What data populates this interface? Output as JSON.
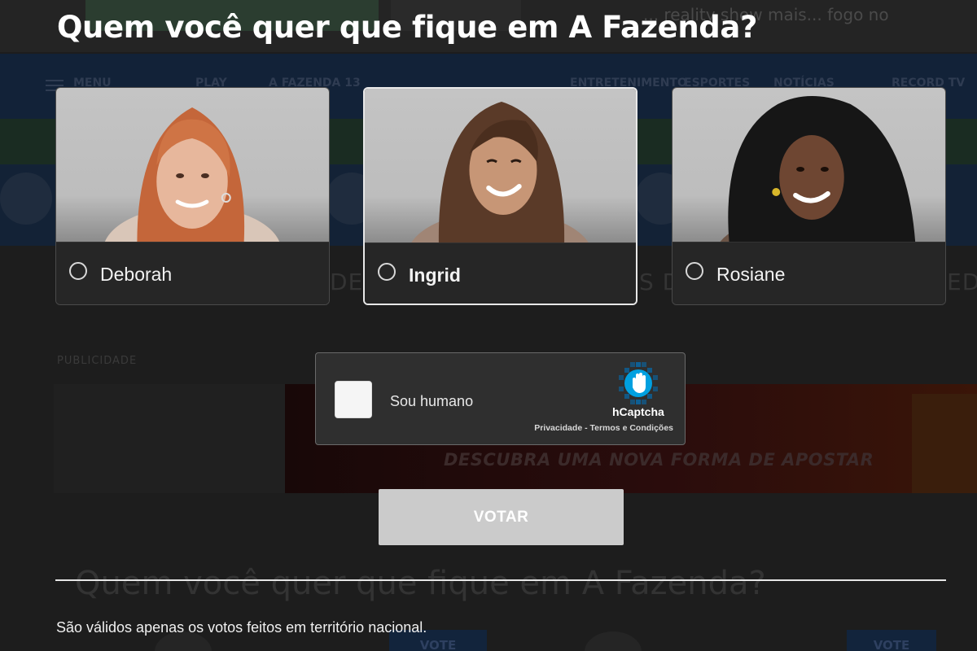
{
  "modal": {
    "title": "Quem você quer que fique em A Fazenda?",
    "candidates": [
      {
        "name": "Deborah",
        "selected": false
      },
      {
        "name": "Ingrid",
        "selected": true
      },
      {
        "name": "Rosiane",
        "selected": false
      }
    ],
    "captcha": {
      "label": "Sou humano",
      "brand": "hCaptcha",
      "privacy_link": "Privacidade",
      "separator": " - ",
      "terms_link": "Termos e Condições",
      "logo_icon": "hcaptcha-hand-icon",
      "accent": "#0074bf"
    },
    "vote_button_label": "VOTAR",
    "disclaimer": "São válidos apenas os votos feitos em território nacional."
  },
  "background": {
    "publicidade_label": "PUBLICIDADE",
    "ad_slogan": "DESCUBRA UMA NOVA FORMA DE APOSTAR",
    "section_title": "Quem você quer que fique em A Fazenda?",
    "vote_label": "VOTE"
  }
}
